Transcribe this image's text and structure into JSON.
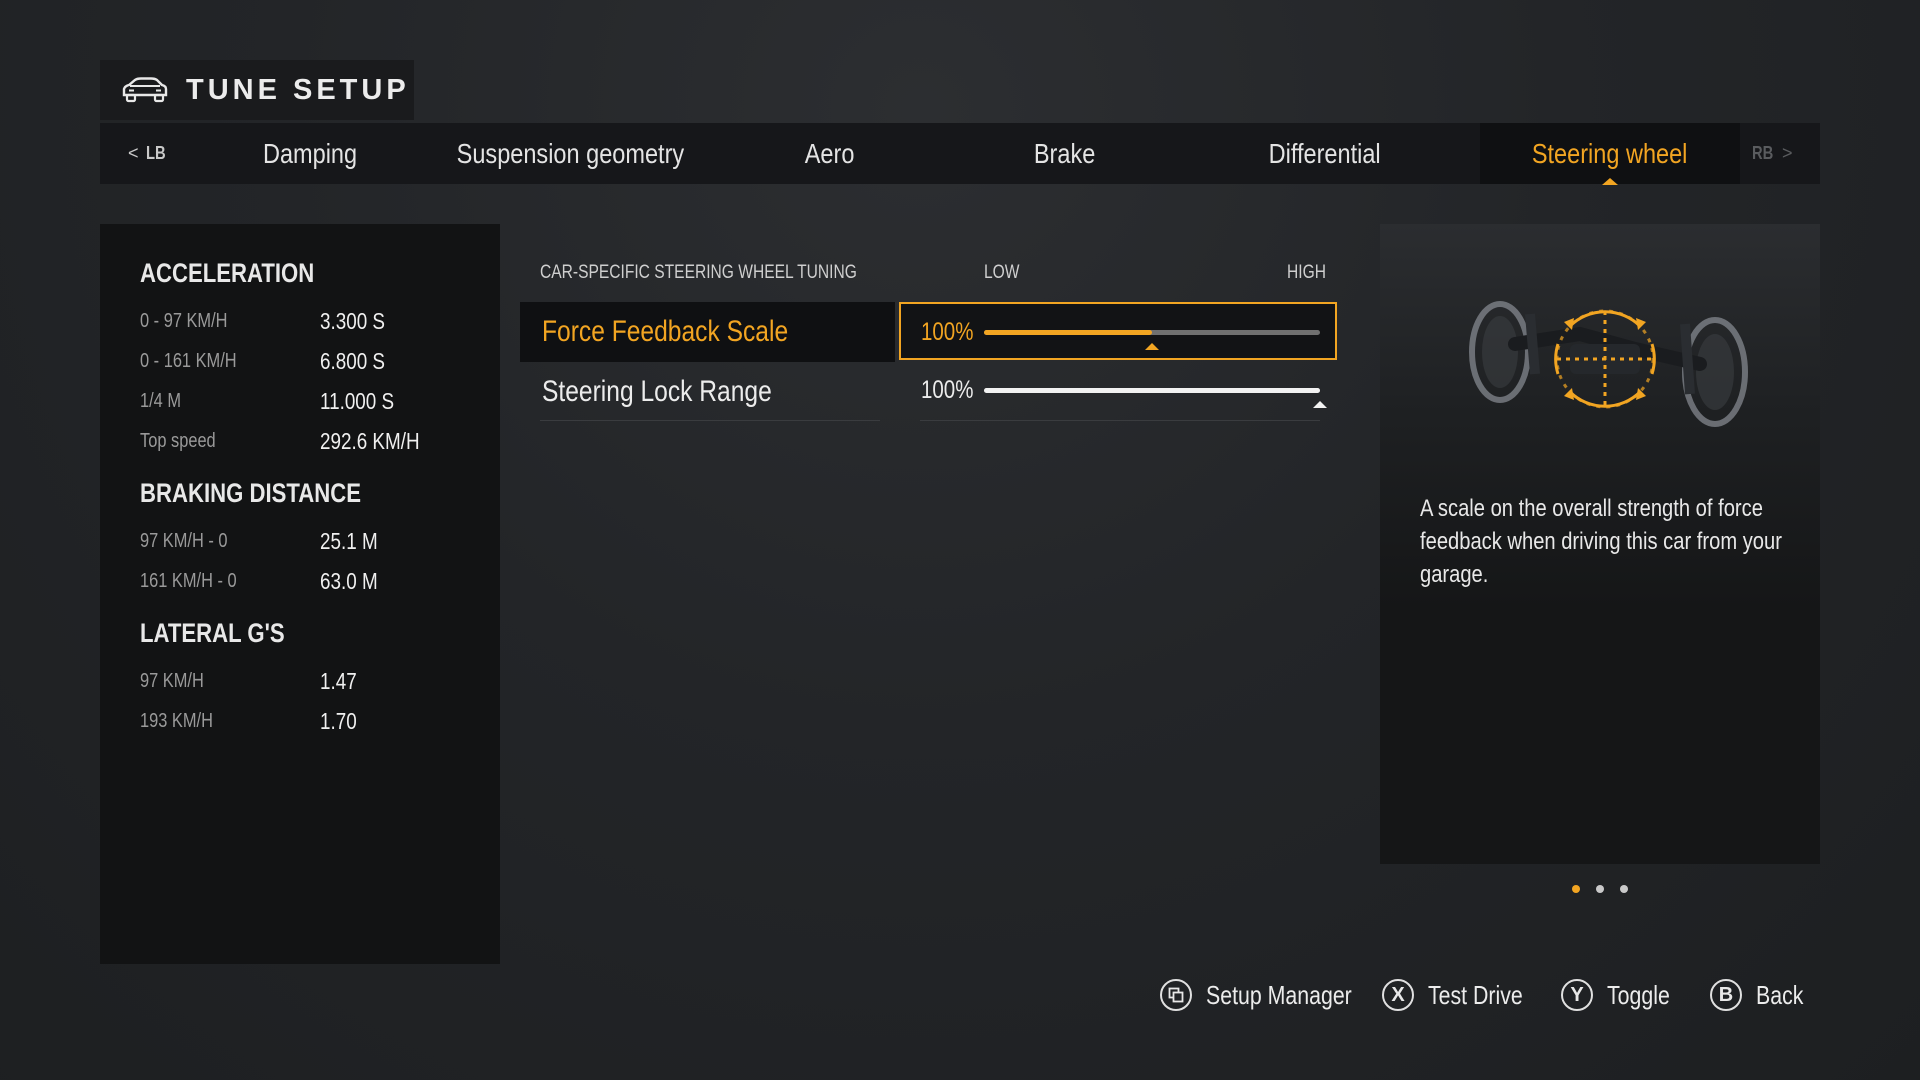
{
  "header": {
    "title": "TUNE SETUP",
    "icon": "car-icon"
  },
  "tabs": {
    "prev_bumper": "LB",
    "next_bumper": "RB",
    "items": [
      "Damping",
      "Suspension geometry",
      "Aero",
      "Brake",
      "Differential",
      "Steering wheel"
    ],
    "active": "Steering wheel"
  },
  "stats": {
    "acceleration": {
      "title": "ACCELERATION",
      "rows": [
        {
          "label": "0 - 97 KM/H",
          "value": "3.300 S"
        },
        {
          "label": "0 - 161 KM/H",
          "value": "6.800 S"
        },
        {
          "label": "1/4 M",
          "value": "11.000 S"
        },
        {
          "label": "Top speed",
          "value": "292.6 KM/H"
        }
      ]
    },
    "braking": {
      "title": "BRAKING DISTANCE",
      "rows": [
        {
          "label": "97 KM/H - 0",
          "value": "25.1 M"
        },
        {
          "label": "161 KM/H - 0",
          "value": "63.0 M"
        }
      ]
    },
    "lateral": {
      "title": "LATERAL G'S",
      "rows": [
        {
          "label": "97 KM/H",
          "value": "1.47"
        },
        {
          "label": "193 KM/H",
          "value": "1.70"
        }
      ]
    }
  },
  "tuning": {
    "section_title": "CAR-SPECIFIC STEERING WHEEL TUNING",
    "low_label": "LOW",
    "high_label": "HIGH",
    "rows": [
      {
        "label": "Force Feedback Scale",
        "value": "100%",
        "level": 0.5,
        "selected": true
      },
      {
        "label": "Steering Lock Range",
        "value": "100%",
        "level": 1.0,
        "selected": false
      }
    ]
  },
  "info": {
    "description": "A scale on the overall strength of force feedback when driving this car from your garage.",
    "pages": 3,
    "current_page": 1
  },
  "footer": {
    "buttons": [
      {
        "icon": "setup-manager-icon",
        "glyph": "",
        "label": "Setup Manager"
      },
      {
        "icon": "x-button-icon",
        "glyph": "X",
        "label": "Test Drive"
      },
      {
        "icon": "y-button-icon",
        "glyph": "Y",
        "label": "Toggle"
      },
      {
        "icon": "b-button-icon",
        "glyph": "B",
        "label": "Back"
      }
    ]
  },
  "colors": {
    "accent": "#f2a522",
    "panel": "#121314",
    "background": "#232528"
  }
}
